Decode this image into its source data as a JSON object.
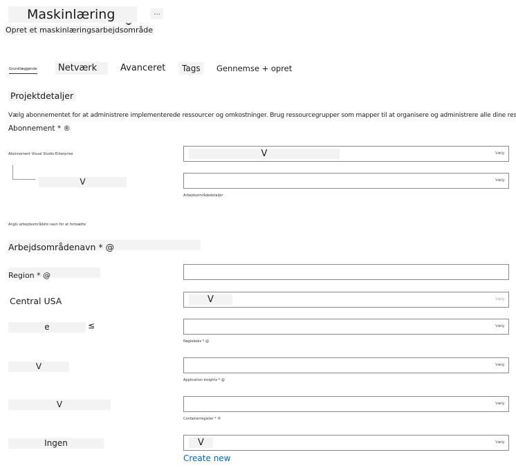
{
  "header": {
    "title": "Maskinlæring",
    "more": "...",
    "subtitle": "Opret et maskinlæringsarbejdsområde"
  },
  "tabs": [
    {
      "label": "Grundlæggende"
    },
    {
      "label": "Netværk"
    },
    {
      "label": "Avanceret"
    },
    {
      "label": "Tags"
    },
    {
      "label": "Gennemse + opret"
    }
  ],
  "project": {
    "title": "Projektdetaljer",
    "description": "Vælg abonnementet for at administrere implementerede ressourcer og omkostninger. Brug ressourcegrupper som mapper til at organisere og administrere alle dine ressourcer.",
    "subscription_label": "Abonnement * ®",
    "subscription_row_label": "Abonnement Visual Studio Enterprise",
    "subscription_value": "V",
    "subscription_end": "Vælg",
    "resource_group_value": "V",
    "resource_group_end": "Vælg",
    "resource_group_caption": "Arbejdsområdedetaljer"
  },
  "workspace": {
    "caption": "Angiv arbejdsområdets navn for at fortsætte",
    "name_label": "Arbejdsområdenavn * @",
    "region_label": "Region * @",
    "region_value": "Central USA",
    "region_select": "V",
    "region_end": "Vælg",
    "storage_value": "e",
    "storage_icon": "≤",
    "storage_end": "Vælg",
    "keyvault_caption": "Nøgleboks * @",
    "keyvault_value": "V",
    "keyvault_end": "Vælg",
    "appinsights_caption": "Application Insights * @",
    "appinsights_value": "V",
    "appinsights_end": "Vælg",
    "registry_caption": "Containerregister * ®",
    "registry_value": "Ingen",
    "registry_select": "V",
    "registry_end": "Vælg",
    "create_new": "Create new"
  }
}
